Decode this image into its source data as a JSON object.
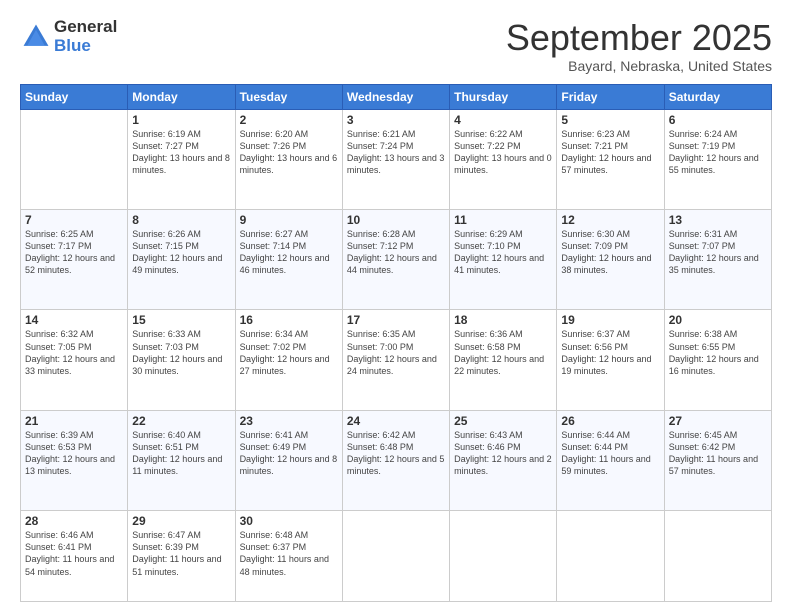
{
  "logo": {
    "general": "General",
    "blue": "Blue"
  },
  "header": {
    "month": "September 2025",
    "location": "Bayard, Nebraska, United States"
  },
  "days_of_week": [
    "Sunday",
    "Monday",
    "Tuesday",
    "Wednesday",
    "Thursday",
    "Friday",
    "Saturday"
  ],
  "weeks": [
    [
      {
        "day": "",
        "sunrise": "",
        "sunset": "",
        "daylight": ""
      },
      {
        "day": "1",
        "sunrise": "Sunrise: 6:19 AM",
        "sunset": "Sunset: 7:27 PM",
        "daylight": "Daylight: 13 hours and 8 minutes."
      },
      {
        "day": "2",
        "sunrise": "Sunrise: 6:20 AM",
        "sunset": "Sunset: 7:26 PM",
        "daylight": "Daylight: 13 hours and 6 minutes."
      },
      {
        "day": "3",
        "sunrise": "Sunrise: 6:21 AM",
        "sunset": "Sunset: 7:24 PM",
        "daylight": "Daylight: 13 hours and 3 minutes."
      },
      {
        "day": "4",
        "sunrise": "Sunrise: 6:22 AM",
        "sunset": "Sunset: 7:22 PM",
        "daylight": "Daylight: 13 hours and 0 minutes."
      },
      {
        "day": "5",
        "sunrise": "Sunrise: 6:23 AM",
        "sunset": "Sunset: 7:21 PM",
        "daylight": "Daylight: 12 hours and 57 minutes."
      },
      {
        "day": "6",
        "sunrise": "Sunrise: 6:24 AM",
        "sunset": "Sunset: 7:19 PM",
        "daylight": "Daylight: 12 hours and 55 minutes."
      }
    ],
    [
      {
        "day": "7",
        "sunrise": "Sunrise: 6:25 AM",
        "sunset": "Sunset: 7:17 PM",
        "daylight": "Daylight: 12 hours and 52 minutes."
      },
      {
        "day": "8",
        "sunrise": "Sunrise: 6:26 AM",
        "sunset": "Sunset: 7:15 PM",
        "daylight": "Daylight: 12 hours and 49 minutes."
      },
      {
        "day": "9",
        "sunrise": "Sunrise: 6:27 AM",
        "sunset": "Sunset: 7:14 PM",
        "daylight": "Daylight: 12 hours and 46 minutes."
      },
      {
        "day": "10",
        "sunrise": "Sunrise: 6:28 AM",
        "sunset": "Sunset: 7:12 PM",
        "daylight": "Daylight: 12 hours and 44 minutes."
      },
      {
        "day": "11",
        "sunrise": "Sunrise: 6:29 AM",
        "sunset": "Sunset: 7:10 PM",
        "daylight": "Daylight: 12 hours and 41 minutes."
      },
      {
        "day": "12",
        "sunrise": "Sunrise: 6:30 AM",
        "sunset": "Sunset: 7:09 PM",
        "daylight": "Daylight: 12 hours and 38 minutes."
      },
      {
        "day": "13",
        "sunrise": "Sunrise: 6:31 AM",
        "sunset": "Sunset: 7:07 PM",
        "daylight": "Daylight: 12 hours and 35 minutes."
      }
    ],
    [
      {
        "day": "14",
        "sunrise": "Sunrise: 6:32 AM",
        "sunset": "Sunset: 7:05 PM",
        "daylight": "Daylight: 12 hours and 33 minutes."
      },
      {
        "day": "15",
        "sunrise": "Sunrise: 6:33 AM",
        "sunset": "Sunset: 7:03 PM",
        "daylight": "Daylight: 12 hours and 30 minutes."
      },
      {
        "day": "16",
        "sunrise": "Sunrise: 6:34 AM",
        "sunset": "Sunset: 7:02 PM",
        "daylight": "Daylight: 12 hours and 27 minutes."
      },
      {
        "day": "17",
        "sunrise": "Sunrise: 6:35 AM",
        "sunset": "Sunset: 7:00 PM",
        "daylight": "Daylight: 12 hours and 24 minutes."
      },
      {
        "day": "18",
        "sunrise": "Sunrise: 6:36 AM",
        "sunset": "Sunset: 6:58 PM",
        "daylight": "Daylight: 12 hours and 22 minutes."
      },
      {
        "day": "19",
        "sunrise": "Sunrise: 6:37 AM",
        "sunset": "Sunset: 6:56 PM",
        "daylight": "Daylight: 12 hours and 19 minutes."
      },
      {
        "day": "20",
        "sunrise": "Sunrise: 6:38 AM",
        "sunset": "Sunset: 6:55 PM",
        "daylight": "Daylight: 12 hours and 16 minutes."
      }
    ],
    [
      {
        "day": "21",
        "sunrise": "Sunrise: 6:39 AM",
        "sunset": "Sunset: 6:53 PM",
        "daylight": "Daylight: 12 hours and 13 minutes."
      },
      {
        "day": "22",
        "sunrise": "Sunrise: 6:40 AM",
        "sunset": "Sunset: 6:51 PM",
        "daylight": "Daylight: 12 hours and 11 minutes."
      },
      {
        "day": "23",
        "sunrise": "Sunrise: 6:41 AM",
        "sunset": "Sunset: 6:49 PM",
        "daylight": "Daylight: 12 hours and 8 minutes."
      },
      {
        "day": "24",
        "sunrise": "Sunrise: 6:42 AM",
        "sunset": "Sunset: 6:48 PM",
        "daylight": "Daylight: 12 hours and 5 minutes."
      },
      {
        "day": "25",
        "sunrise": "Sunrise: 6:43 AM",
        "sunset": "Sunset: 6:46 PM",
        "daylight": "Daylight: 12 hours and 2 minutes."
      },
      {
        "day": "26",
        "sunrise": "Sunrise: 6:44 AM",
        "sunset": "Sunset: 6:44 PM",
        "daylight": "Daylight: 11 hours and 59 minutes."
      },
      {
        "day": "27",
        "sunrise": "Sunrise: 6:45 AM",
        "sunset": "Sunset: 6:42 PM",
        "daylight": "Daylight: 11 hours and 57 minutes."
      }
    ],
    [
      {
        "day": "28",
        "sunrise": "Sunrise: 6:46 AM",
        "sunset": "Sunset: 6:41 PM",
        "daylight": "Daylight: 11 hours and 54 minutes."
      },
      {
        "day": "29",
        "sunrise": "Sunrise: 6:47 AM",
        "sunset": "Sunset: 6:39 PM",
        "daylight": "Daylight: 11 hours and 51 minutes."
      },
      {
        "day": "30",
        "sunrise": "Sunrise: 6:48 AM",
        "sunset": "Sunset: 6:37 PM",
        "daylight": "Daylight: 11 hours and 48 minutes."
      },
      {
        "day": "",
        "sunrise": "",
        "sunset": "",
        "daylight": ""
      },
      {
        "day": "",
        "sunrise": "",
        "sunset": "",
        "daylight": ""
      },
      {
        "day": "",
        "sunrise": "",
        "sunset": "",
        "daylight": ""
      },
      {
        "day": "",
        "sunrise": "",
        "sunset": "",
        "daylight": ""
      }
    ]
  ]
}
